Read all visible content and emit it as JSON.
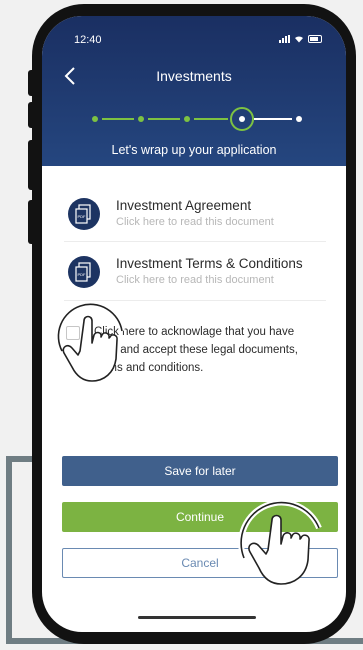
{
  "status_bar": {
    "time": "12:40"
  },
  "header": {
    "title": "Investments",
    "subtitle": "Let's wrap up your application"
  },
  "documents": [
    {
      "title": "Investment Agreement",
      "subtitle": "Click here to read this document",
      "icon": "pdf-icon"
    },
    {
      "title": "Investment Terms & Conditions",
      "subtitle": "Click here to read this document",
      "icon": "pdf-icon"
    }
  ],
  "acknowledge": {
    "text_line1": "Click here to acknowlage that you have",
    "text_line2": "read and accept these legal documents,",
    "text_line3": "terms and conditions.",
    "checked": false
  },
  "buttons": {
    "save": "Save for later",
    "continue": "Continue",
    "cancel": "Cancel"
  },
  "stepper": {
    "total_steps": 5,
    "current_step": 4
  },
  "colors": {
    "header": "#1f3a6f",
    "accent_green": "#7cb342",
    "save_button": "#40608c",
    "cancel_border": "#6a8ab2",
    "connector": "#6f7d83"
  }
}
